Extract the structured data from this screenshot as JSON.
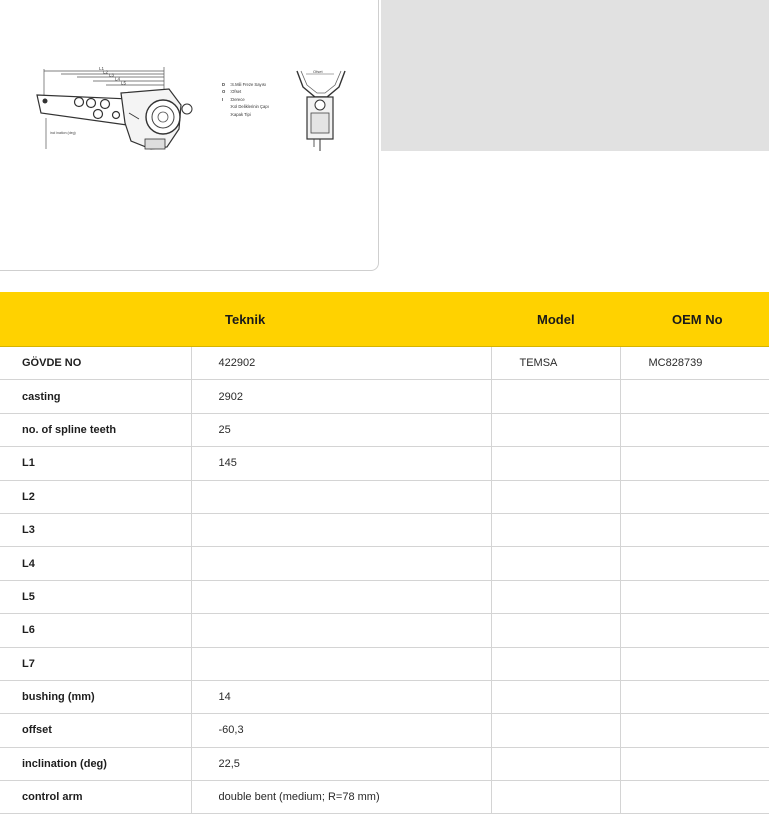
{
  "diagram": {
    "dims": [
      "L1",
      "L2",
      "L3",
      "L4",
      "L5"
    ],
    "legend": [
      {
        "key": "D",
        "text": ":S.Mili Freze Sayısı"
      },
      {
        "key": "O",
        "text": ":Ofset"
      },
      {
        "key": "I",
        "text": ":Derece"
      },
      {
        "key": "",
        "text": ":Kol Deliklerinin Çapı"
      },
      {
        "key": "",
        "text": ":Kapak Tipi"
      }
    ],
    "side_label": "incl ination (deg)",
    "offset_label": "Ofset"
  },
  "table": {
    "headers": [
      "",
      "Teknik",
      "Model",
      "OEM No"
    ],
    "rows": [
      {
        "label": "GÖVDE NO",
        "teknik": "422902",
        "model": "TEMSA",
        "oem": "MC828739"
      },
      {
        "label": "casting",
        "teknik": "2902",
        "model": "",
        "oem": ""
      },
      {
        "label": "no. of spline teeth",
        "teknik": "25",
        "model": "",
        "oem": ""
      },
      {
        "label": "L1",
        "teknik": "145",
        "model": "",
        "oem": ""
      },
      {
        "label": "L2",
        "teknik": "",
        "model": "",
        "oem": ""
      },
      {
        "label": "L3",
        "teknik": "",
        "model": "",
        "oem": ""
      },
      {
        "label": "L4",
        "teknik": "",
        "model": "",
        "oem": ""
      },
      {
        "label": "L5",
        "teknik": "",
        "model": "",
        "oem": ""
      },
      {
        "label": "L6",
        "teknik": "",
        "model": "",
        "oem": ""
      },
      {
        "label": "L7",
        "teknik": "",
        "model": "",
        "oem": ""
      },
      {
        "label": "bushing (mm)",
        "teknik": "14",
        "model": "",
        "oem": ""
      },
      {
        "label": "offset",
        "teknik": "-60,3",
        "model": "",
        "oem": ""
      },
      {
        "label": "inclination (deg)",
        "teknik": "22,5",
        "model": "",
        "oem": ""
      },
      {
        "label": "control arm",
        "teknik": "double bent (medium; R=78 mm)",
        "model": "",
        "oem": ""
      }
    ]
  },
  "colors": {
    "header_bg": "#ffd200",
    "panel_gray": "#e1e1e1",
    "border": "#d4d4d4"
  }
}
